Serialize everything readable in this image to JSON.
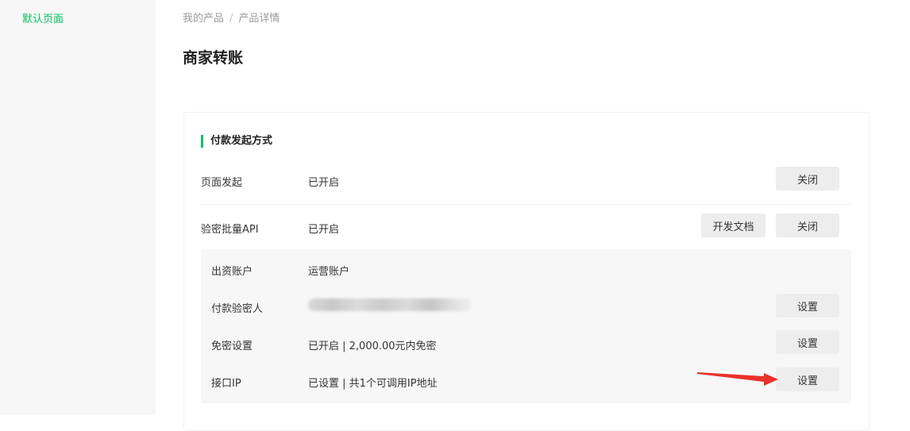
{
  "sidebar": {
    "items": [
      {
        "label": "默认页面"
      }
    ]
  },
  "breadcrumb": {
    "parent": "我的产品",
    "separator": "/",
    "current": "产品详情"
  },
  "page": {
    "title": "商家转账"
  },
  "section": {
    "title": "付款发起方式",
    "rows": [
      {
        "label": "页面发起",
        "status": "已开启",
        "close_label": "关闭"
      },
      {
        "label": "验密批量API",
        "status": "已开启",
        "docs_label": "开发文档",
        "close_label": "关闭"
      }
    ],
    "api_settings": [
      {
        "label": "出资账户",
        "value": "运营账户"
      },
      {
        "label": "付款验密人",
        "value": "",
        "button_label": "设置"
      },
      {
        "label": "免密设置",
        "value": "已开启 | 2,000.00元内免密",
        "button_label": "设置"
      },
      {
        "label": "接口IP",
        "value": "已设置 | 共1个可调用IP地址",
        "button_label": "设置"
      }
    ]
  },
  "colors": {
    "accent": "#07c160",
    "arrow": "#e8322a",
    "button_bg": "#ededed",
    "panel_bg": "#f7f7f7"
  }
}
